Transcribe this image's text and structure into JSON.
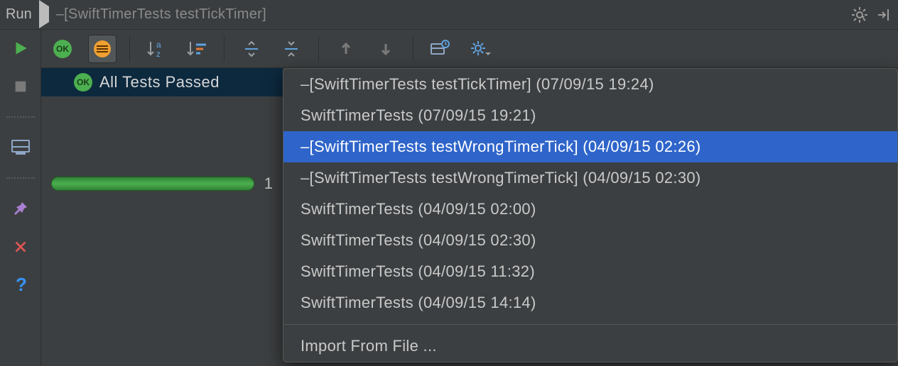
{
  "titlebar": {
    "title": "Run",
    "subtitle": "–[SwiftTimerTests testTickTimer]"
  },
  "gutter": {
    "run_tip": "Run",
    "stop_tip": "Stop",
    "layout_tip": "Layout",
    "pin_tip": "Pin",
    "close_tip": "Close",
    "help_tip": "Help"
  },
  "toolbar": {
    "show_passed_tip": "Show Passed",
    "show_ignored_tip": "Show Ignored",
    "sort_tip": "Sort Alphabetically",
    "sort_duration_tip": "Sort by Duration",
    "expand_tip": "Expand All",
    "collapse_tip": "Collapse All",
    "prev_tip": "Previous Failed",
    "next_tip": "Next Failed",
    "history_tip": "Test History",
    "options_tip": "Options"
  },
  "tree": {
    "root_label": "All Tests Passed",
    "progress_count": "1"
  },
  "dropdown": {
    "items": [
      "–[SwiftTimerTests testTickTimer] (07/09/15 19:24)",
      "SwiftTimerTests (07/09/15 19:21)",
      "–[SwiftTimerTests testWrongTimerTick] (04/09/15 02:26)",
      "–[SwiftTimerTests testWrongTimerTick] (04/09/15 02:30)",
      "SwiftTimerTests (04/09/15 02:00)",
      "SwiftTimerTests (04/09/15 02:30)",
      "SwiftTimerTests (04/09/15 11:32)",
      "SwiftTimerTests (04/09/15 14:14)"
    ],
    "selected_index": 2,
    "import_label": "Import From File ..."
  }
}
